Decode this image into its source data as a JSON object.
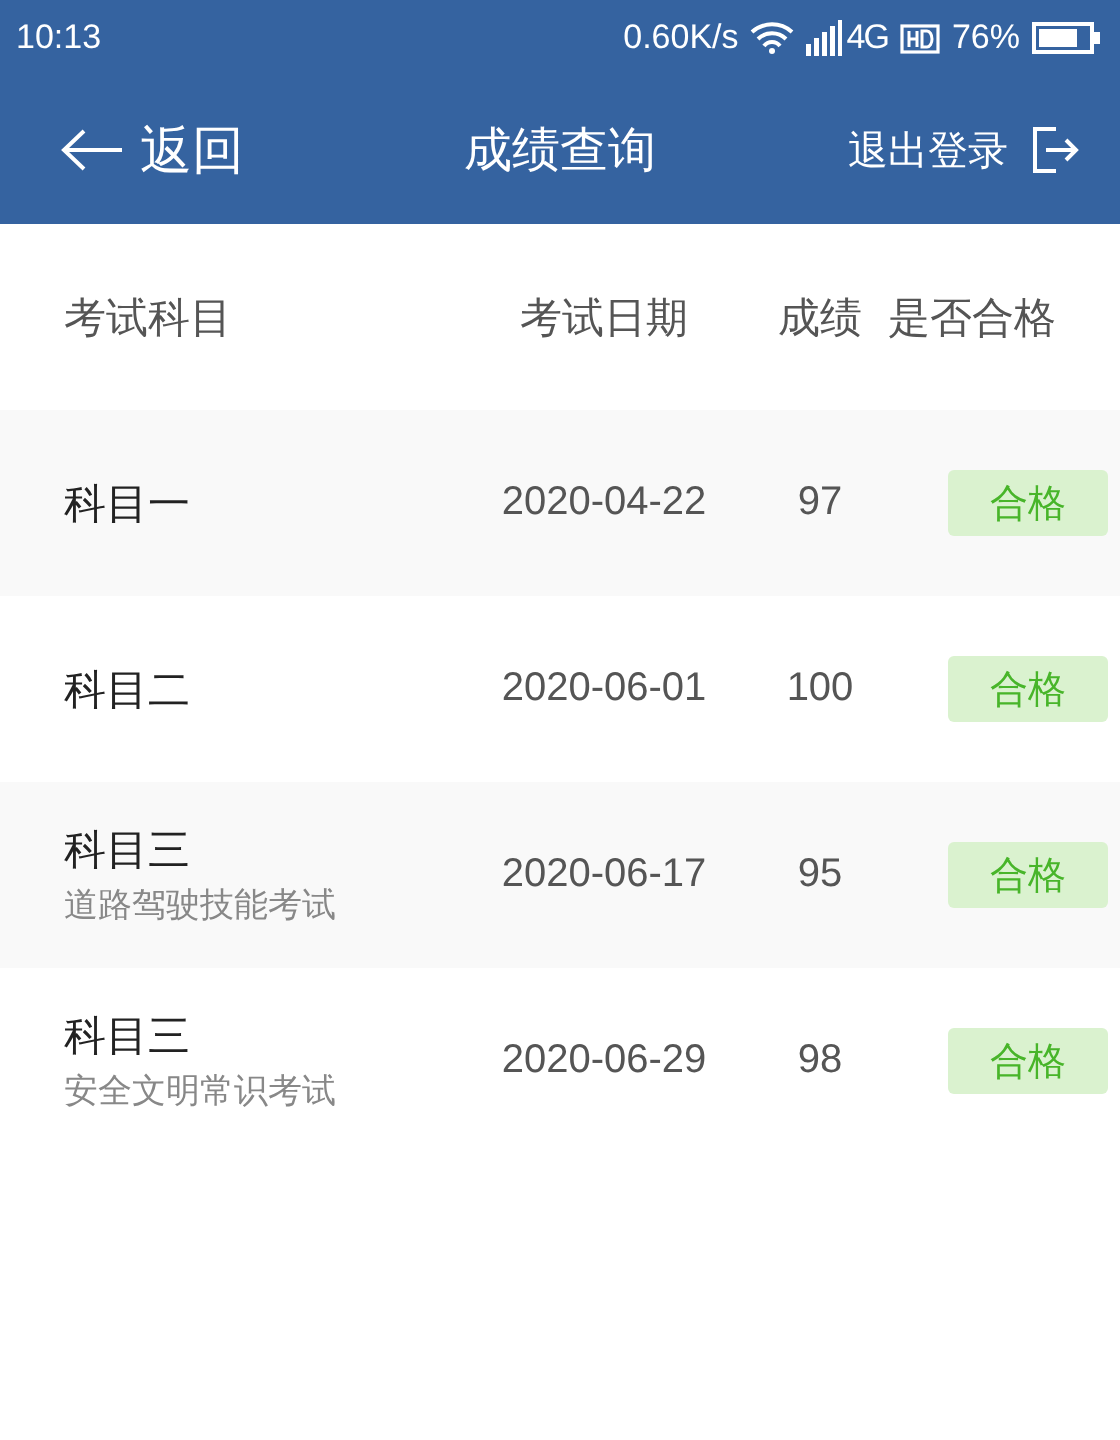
{
  "status_bar": {
    "time": "10:13",
    "speed": "0.60K/s",
    "network": "4G",
    "battery": "76%"
  },
  "header": {
    "back": "返回",
    "title": "成绩查询",
    "logout": "退出登录"
  },
  "table": {
    "columns": [
      "考试科目",
      "考试日期",
      "成绩",
      "是否合格"
    ],
    "rows": [
      {
        "subject": "科目一",
        "date": "2020-04-22",
        "score": "97",
        "result": "合格",
        "passed": true
      },
      {
        "subject": "科目二",
        "date": "2020-06-01",
        "score": "100",
        "result": "合格",
        "passed": true
      },
      {
        "subject": "科目三",
        "note": "道路驾驶技能考试",
        "date": "2020-06-17",
        "score": "95",
        "result": "合格",
        "passed": true
      },
      {
        "subject": "科目三",
        "note": "安全文明常识考试",
        "date": "2020-06-29",
        "score": "98",
        "result": "合格",
        "passed": true
      }
    ]
  }
}
